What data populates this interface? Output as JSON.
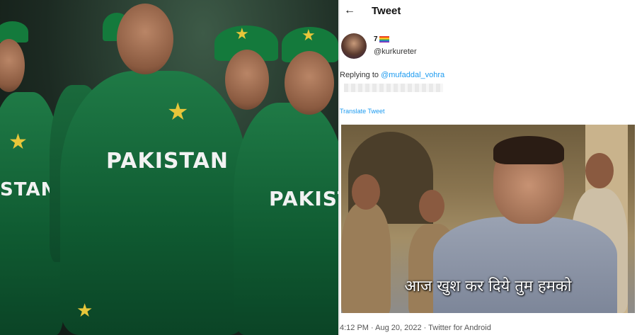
{
  "left_photo": {
    "jersey_words": [
      "PAKISTAN",
      "PAKISTAN",
      "STAN"
    ]
  },
  "tweet": {
    "header_title": "Tweet",
    "display_name": "7",
    "handle": "@kurkureter",
    "replying_prefix": "Replying to ",
    "replying_to": "@mufaddal_vohra",
    "translate_label": "Translate Tweet",
    "meme_caption": "आज खुश कर दिये तुम हमको",
    "footer": "4:12 PM · Aug 20, 2022 · Twitter for Android"
  },
  "icons": {
    "back": "back-arrow-icon"
  },
  "colors": {
    "jersey_green": "#147a3c",
    "star_yellow": "#e8c63a",
    "link_blue": "#1d9bf0"
  }
}
